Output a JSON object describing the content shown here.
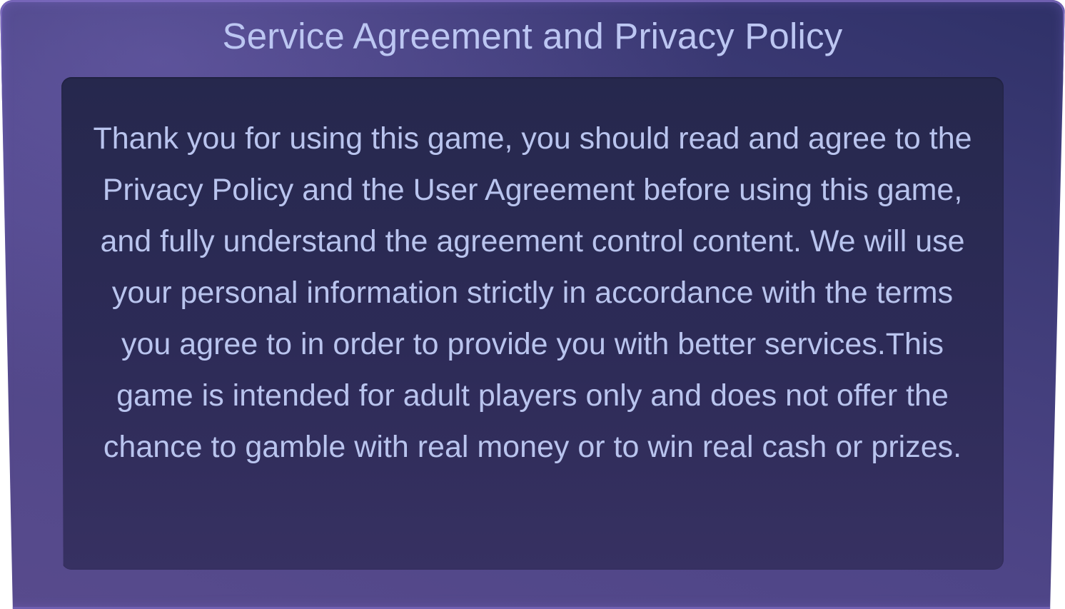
{
  "dialog": {
    "title": "Service Agreement and Privacy Policy",
    "body": "Thank you for using this game, you should read and agree to the Privacy Policy and the User Agreement before using this game, and fully understand the agreement control content. We will use your personal information strictly in accordance with the terms you agree to in order to provide you with better services.This game is intended for adult players only and does not offer the chance to gamble with real money or to win real cash or prizes."
  },
  "colors": {
    "frame": "#4e4587",
    "panel": "#2d2b57",
    "text": "#b9c4ee"
  }
}
